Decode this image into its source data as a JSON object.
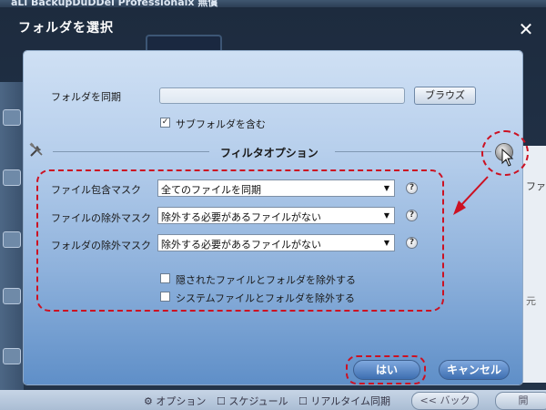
{
  "app": {
    "title_fragment": "aLl BackupDuDDel Professionalx 無償",
    "bottom_bar": {
      "options": "オプション",
      "schedule": "スケジュール",
      "realtime_sync": "リアルタイム同期",
      "back": "<< バック",
      "next": "開"
    },
    "right_cut_text": "ファ",
    "right_cut_text2": "元"
  },
  "dialog": {
    "title": "フォルダを選択",
    "sync_folder": {
      "label": "フォルダを同期",
      "value": "",
      "browse_label": "ブラウズ"
    },
    "include_subfolders": {
      "label": "サブフォルダを含む",
      "checked": true
    },
    "filter_section": {
      "title": "フィルタオプション"
    },
    "filters": [
      {
        "label": "ファイル包含マスク",
        "value": "全てのファイルを同期"
      },
      {
        "label": "ファイルの除外マスク",
        "value": "除外する必要があるファイルがない"
      },
      {
        "label": "フォルダの除外マスク",
        "value": "除外する必要があるファイルがない"
      }
    ],
    "exclude_hidden": {
      "label": "隠されたファイルとフォルダを除外する",
      "checked": false
    },
    "exclude_system": {
      "label": "システムファイルとフォルダを除外する",
      "checked": false
    },
    "buttons": {
      "ok": "はい",
      "cancel": "キャンセル"
    }
  },
  "colors": {
    "annotation": "#cc1122",
    "panel_top": "#cfe0f4",
    "panel_bottom": "#5f8fc8",
    "button": "#3e6fb1"
  },
  "icons": {
    "close": "close-icon",
    "tools": "tools-icon",
    "toggle": "expand-toggle-icon",
    "help": "help-icon",
    "dropdown": "chevron-down-icon"
  }
}
